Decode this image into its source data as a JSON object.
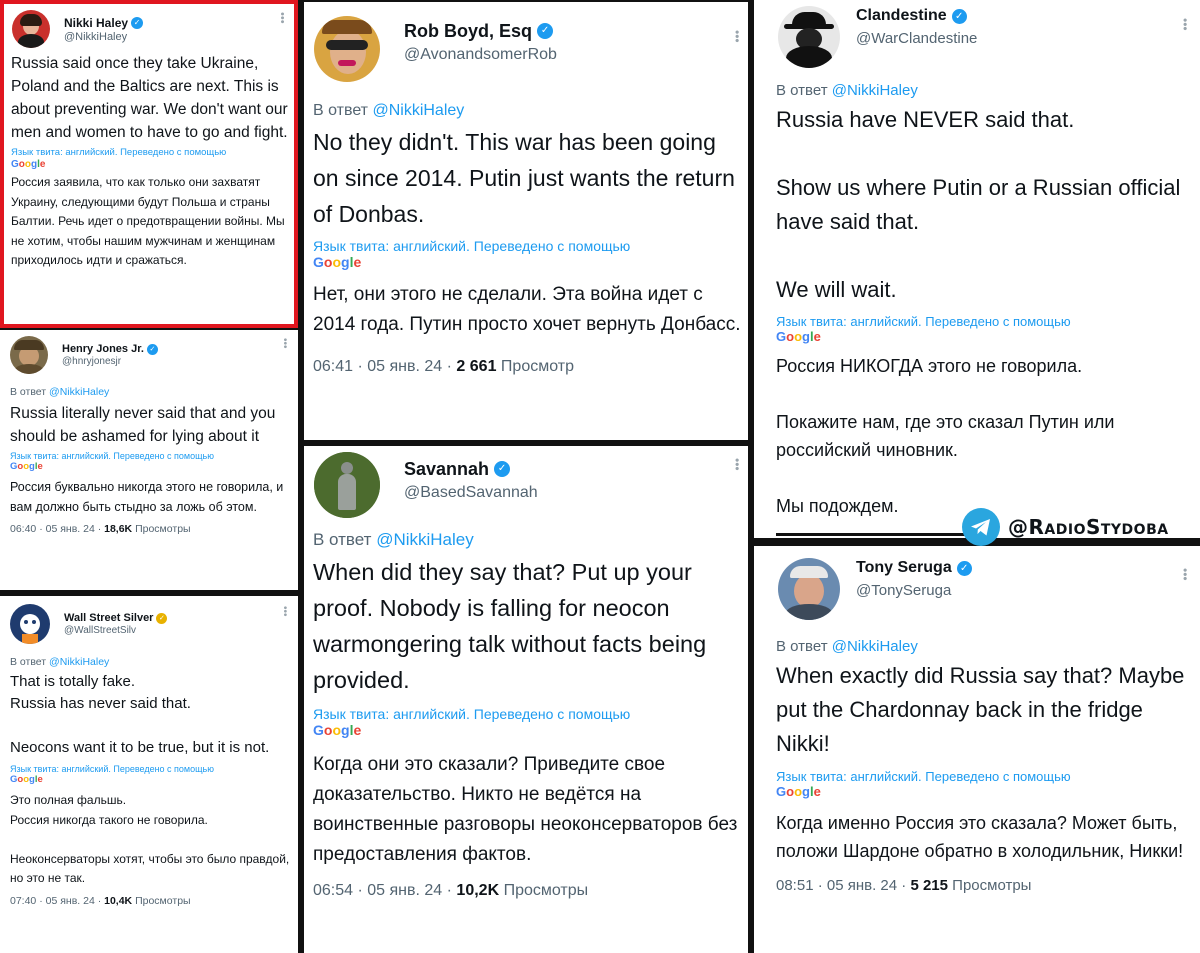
{
  "translation_note": "Язык твита: английский. Переведено с помощью",
  "google_label": "Google",
  "reply_prefix": "В ответ",
  "tweets": [
    {
      "id": "haley",
      "name": "Nikki Haley",
      "handle": "@NikkiHaley",
      "badge": "blue",
      "text": "Russia said once they take Ukraine, Poland and the Baltics are next. This is about preventing war. We don't want our men and women to have to go and fight.",
      "translated": "Россия заявила, что как только они захватят Украину, следующими будут Польша и страны Балтии. Речь идет о предотвращении войны. Мы не хотим, чтобы нашим мужчинам и женщинам приходилось идти и сражаться."
    },
    {
      "id": "jones",
      "name": "Henry Jones Jr.",
      "handle": "@hnryjonesjr",
      "badge": "blue",
      "reply_to": "@NikkiHaley",
      "text": "Russia literally never said that and you should be ashamed for lying about it",
      "translated": "Россия буквально никогда этого не говорила, и вам должно быть стыдно за ложь об этом.",
      "time": "06:40 · 05 янв. 24 ·",
      "views": "18,6K",
      "views_label": "Просмотры"
    },
    {
      "id": "wss",
      "name": "Wall Street Silver",
      "handle": "@WallStreetSilv",
      "badge": "gold",
      "reply_to": "@NikkiHaley",
      "text": "That is totally fake.\nRussia has never said that.\n\nNeocons want it to be true, but it is not.",
      "translated": "Это полная фальшь.\nРоссия никогда такого не говорила.\n\nНеоконсерваторы хотят, чтобы это было правдой, но это не так.",
      "time": "07:40 · 05 янв. 24 ·",
      "views": "10,4K",
      "views_label": "Просмотры"
    },
    {
      "id": "boyd",
      "name": "Rob Boyd, Esq",
      "handle": "@AvonandsomerRob",
      "badge": "blue",
      "reply_to": "@NikkiHaley",
      "text": "No they didn't. This war has been going on since 2014. Putin just wants the return of Donbas.",
      "translated": "Нет, они этого не сделали. Эта война идет с 2014 года. Путин просто хочет вернуть Донбасс.",
      "time": "06:41 · 05 янв. 24 ·",
      "views": "2 661",
      "views_label": "Просмотр"
    },
    {
      "id": "savannah",
      "name": "Savannah",
      "handle": "@BasedSavannah",
      "badge": "blue",
      "reply_to": "@NikkiHaley",
      "text": "When did they say that? Put up your proof. Nobody is falling for neocon warmongering talk without facts being provided.",
      "translated": "Когда они это сказали? Приведите свое доказательство. Никто не ведётся на воинственные разговоры неоконсерваторов без предоставления фактов.",
      "time": "06:54 · 05 янв. 24 ·",
      "views": "10,2K",
      "views_label": "Просмотры"
    },
    {
      "id": "clandestine",
      "name": "Clandestine",
      "handle": "@WarClandestine",
      "badge": "blue",
      "reply_to": "@NikkiHaley",
      "text": "Russia have NEVER said that.\n\nShow us where Putin or a Russian official have said that.\n\nWe will wait.",
      "translated": "Россия НИКОГДА этого не говорила.\n\nПокажите нам, где это сказал Путин или российский чиновник.\n\nМы подождем."
    },
    {
      "id": "seruga",
      "name": "Tony Seruga",
      "handle": "@TonySeruga",
      "badge": "blue",
      "reply_to": "@NikkiHaley",
      "text": "When exactly did Russia say that? Maybe put the Chardonnay back in the fridge Nikki!",
      "translated": "Когда именно Россия это сказала? Может быть, положи Шардоне обратно в холодильник, Никки!",
      "time": "08:51 · 05 янв. 24 ·",
      "views": "5 215",
      "views_label": "Просмотры"
    }
  ],
  "watermark": "@RadioStydoba"
}
